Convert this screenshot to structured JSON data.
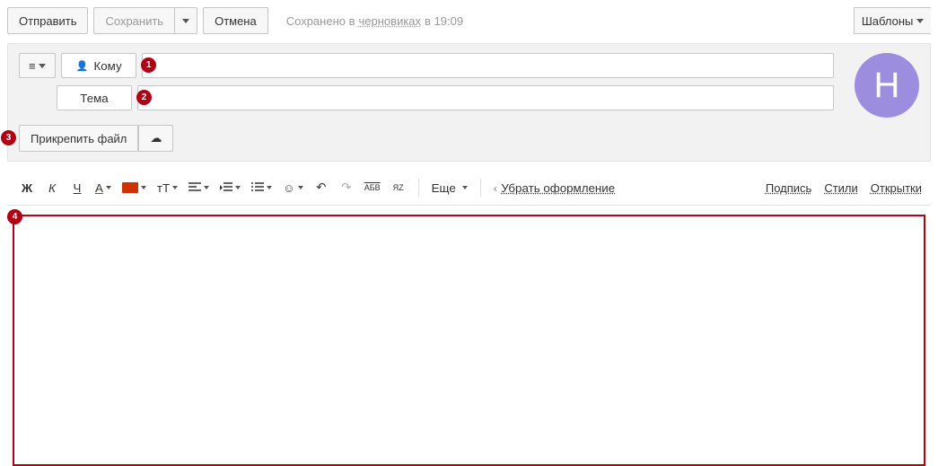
{
  "topbar": {
    "send": "Отправить",
    "save": "Сохранить",
    "cancel": "Отмена",
    "status_pre": "Сохранено в",
    "status_link": "черновиках",
    "status_post": "в 19:09",
    "templates": "Шаблоны"
  },
  "fields": {
    "to_label": "Кому",
    "subject_label": "Тема",
    "attach": "Прикрепить файл"
  },
  "avatar": {
    "letter": "Н"
  },
  "toolbar": {
    "bold": "Ж",
    "italic": "К",
    "under": "Ч",
    "fontcolor": "A",
    "az": "тТ",
    "abc": "АБВ",
    "yaz": "Я",
    "yaz2": "Z",
    "more": "Еще",
    "clearfmt": "Убрать оформление",
    "signature": "Подпись",
    "styles": "Стили",
    "cards": "Открытки"
  },
  "annotations": {
    "a1": "1",
    "a2": "2",
    "a3": "3",
    "a4": "4"
  }
}
